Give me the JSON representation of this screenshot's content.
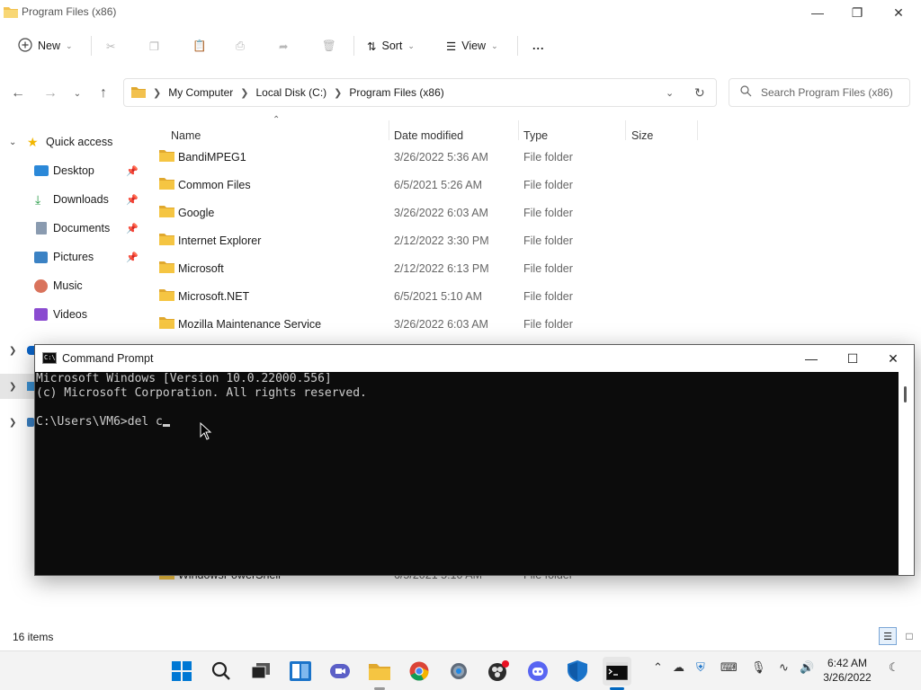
{
  "explorer": {
    "title": "Program Files (x86)",
    "toolbar": {
      "new_label": "New",
      "sort_label": "Sort",
      "view_label": "View",
      "more_label": "..."
    },
    "breadcrumb": [
      "My Computer",
      "Local Disk (C:)",
      "Program Files (x86)"
    ],
    "search_placeholder": "Search Program Files (x86)",
    "sidebar": {
      "quick_access": "Quick access",
      "items": [
        {
          "label": "Desktop",
          "icon": "desktop-icon",
          "pinned": true
        },
        {
          "label": "Downloads",
          "icon": "downloads-icon",
          "pinned": true
        },
        {
          "label": "Documents",
          "icon": "documents-icon",
          "pinned": true
        },
        {
          "label": "Pictures",
          "icon": "pictures-icon",
          "pinned": true
        },
        {
          "label": "Music",
          "icon": "music-icon",
          "pinned": false
        },
        {
          "label": "Videos",
          "icon": "videos-icon",
          "pinned": false
        }
      ]
    },
    "columns": {
      "name": "Name",
      "date": "Date modified",
      "type": "Type",
      "size": "Size"
    },
    "rows": [
      {
        "name": "BandiMPEG1",
        "date": "3/26/2022 5:36 AM",
        "type": "File folder"
      },
      {
        "name": "Common Files",
        "date": "6/5/2021 5:26 AM",
        "type": "File folder"
      },
      {
        "name": "Google",
        "date": "3/26/2022 6:03 AM",
        "type": "File folder"
      },
      {
        "name": "Internet Explorer",
        "date": "2/12/2022 3:30 PM",
        "type": "File folder"
      },
      {
        "name": "Microsoft",
        "date": "2/12/2022 6:13 PM",
        "type": "File folder"
      },
      {
        "name": "Microsoft.NET",
        "date": "6/5/2021 5:10 AM",
        "type": "File folder"
      },
      {
        "name": "Mozilla Maintenance Service",
        "date": "3/26/2022 6:03 AM",
        "type": "File folder"
      },
      {
        "name": "WindowsPowerShell",
        "date": "6/5/2021 5:10 AM",
        "type": "File folder"
      }
    ],
    "status": "16 items"
  },
  "cmd": {
    "title": "Command Prompt",
    "lines": [
      "Microsoft Windows [Version 10.0.22000.556]",
      "(c) Microsoft Corporation. All rights reserved.",
      "",
      "C:\\Users\\VM6>del c"
    ]
  },
  "taskbar": {
    "time": "6:42 AM",
    "date": "3/26/2022"
  },
  "colors": {
    "accent": "#0067c0",
    "folder": "#f2c14e",
    "console_bg": "#0c0c0c",
    "console_fg": "#cccccc"
  }
}
